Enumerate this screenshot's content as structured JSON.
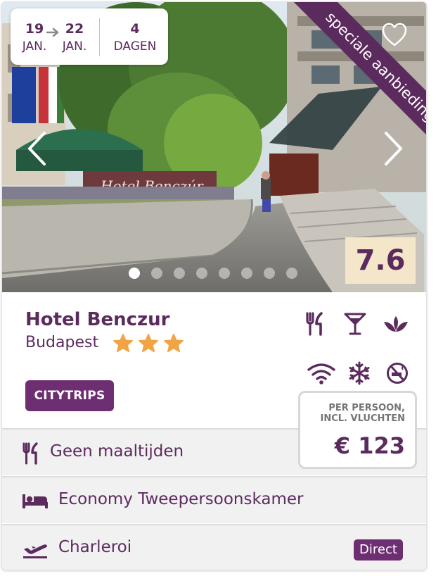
{
  "dates": {
    "from_day": "19",
    "from_month": "JAN.",
    "to_day": "22",
    "to_month": "JAN.",
    "nights": "4",
    "nights_label": "DAGEN"
  },
  "ribbon": "speciale aanbieding",
  "score": "7.6",
  "carousel": {
    "slides": 8,
    "active": 1
  },
  "hotel": {
    "name": "Hotel Benczur",
    "city": "Budapest",
    "stars": 3,
    "tag": "CITYTRIPS",
    "facility_icons": [
      "restaurant-icon",
      "bar-icon",
      "spa-icon",
      "wifi-icon",
      "airco-icon",
      "no-smoking-icon"
    ]
  },
  "price": {
    "label_line1": "PER PERSOON,",
    "label_line2": "INCL. VLUCHTEN",
    "value": "€ 123"
  },
  "rows": {
    "meals": {
      "icon": "cutlery-icon",
      "label": "Geen maaltijden"
    },
    "room": {
      "icon": "bed-icon",
      "label": "Economy Tweepersoonskamer"
    },
    "flight": {
      "icon": "plane-icon",
      "label": "Charleroi",
      "badge": "Direct"
    }
  },
  "colors": {
    "brand_purple": "#5c2b5e",
    "tag_purple": "#6e2e72",
    "star_orange": "#f0a445",
    "score_bg": "#f4e7c9"
  }
}
